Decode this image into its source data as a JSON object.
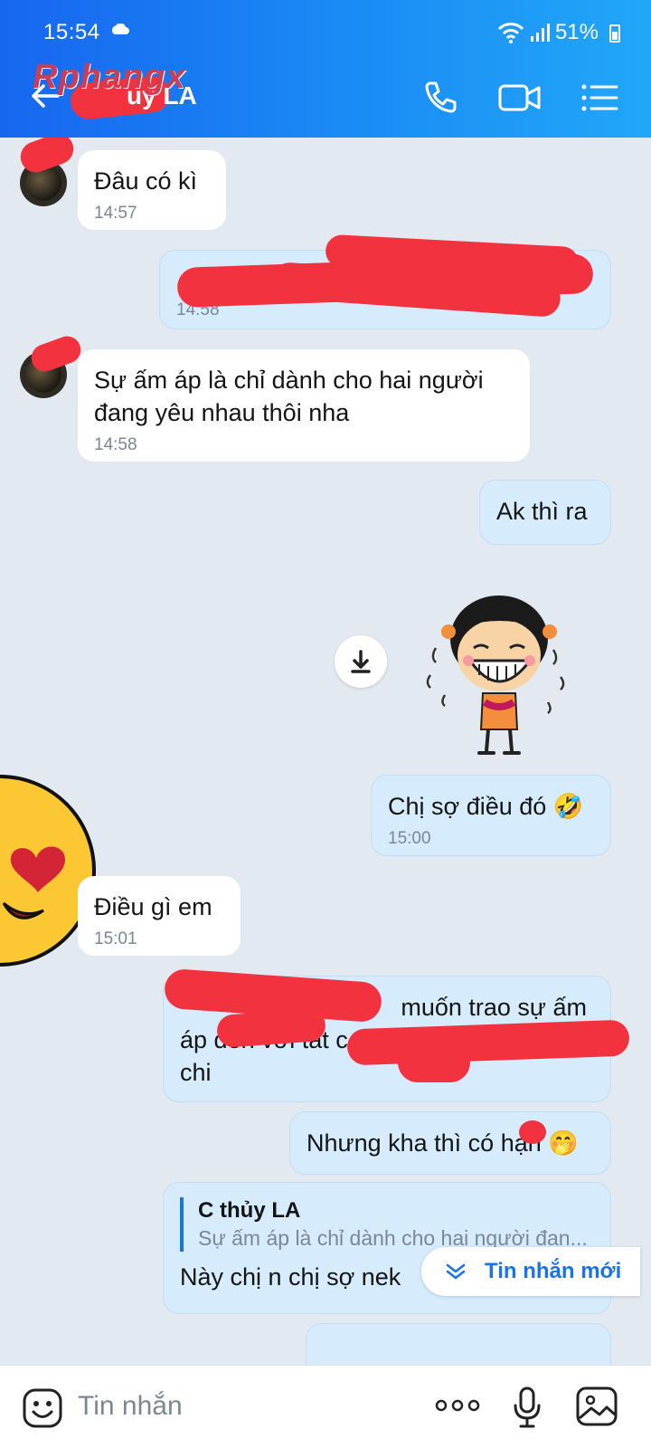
{
  "status_bar": {
    "time": "15:54",
    "battery": "51%"
  },
  "header": {
    "contact_name": "uy LA",
    "watermark": "Rphangx"
  },
  "messages": [
    {
      "dir": "in",
      "text": "Đâu có kì",
      "time": "14:57"
    },
    {
      "dir": "out",
      "text": "",
      "time": "14:58"
    },
    {
      "dir": "in",
      "text": "Sự ấm áp là chỉ dành cho hai người đang yêu nhau thôi nha",
      "time": "14:58"
    },
    {
      "dir": "out",
      "text": "Ak thì ra",
      "time": ""
    },
    {
      "dir": "out",
      "text": "Chị sợ điều đó 🤣",
      "time": "15:00"
    },
    {
      "dir": "in",
      "text": "Điều gì em",
      "time": "15:01"
    },
    {
      "dir": "out",
      "text_line1": "muốn trao sự ấm",
      "text_line2": "áp đến với tất c",
      "text_line3": "chi",
      "time": ""
    },
    {
      "dir": "out",
      "text": "Nhưng kha thì có hạn 🤭",
      "time": ""
    },
    {
      "dir": "out",
      "reply_name": "C thủy LA",
      "reply_text": "Sự ấm áp là chỉ dành cho hai người đan...",
      "text": "Này chị n chị sợ nek",
      "time": ""
    }
  ],
  "new_messages_label": "Tin nhắn mới",
  "input": {
    "placeholder": "Tin nhắn"
  },
  "colors": {
    "header_start": "#1766ef",
    "header_end": "#21a7f8",
    "bubble_out": "#d6ecfd",
    "bubble_in": "#ffffff",
    "accent": "#1a73e8",
    "redaction": "#f2333f"
  }
}
